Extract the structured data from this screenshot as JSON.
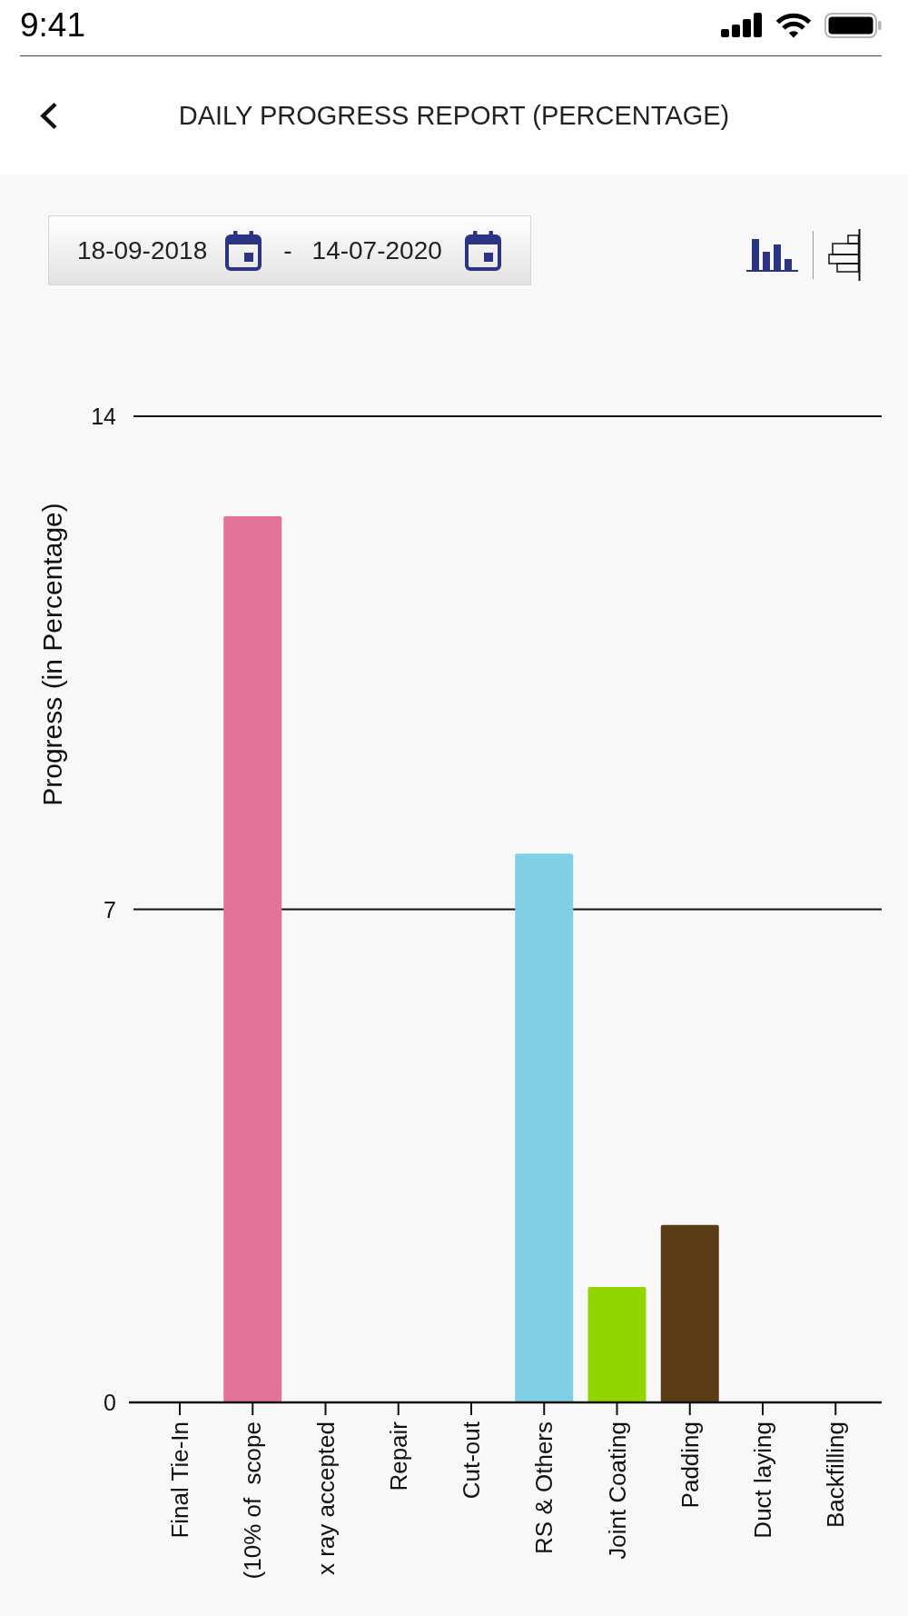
{
  "status_bar": {
    "time": "9:41"
  },
  "header": {
    "title": "DAILY PROGRESS REPORT (PERCENTAGE)"
  },
  "date_range": {
    "start": "18-09-2018",
    "separator": "-",
    "end": "14-07-2020"
  },
  "chart_view_toggle": [
    {
      "kind": "vertical",
      "selected": true
    },
    {
      "kind": "horizontal",
      "selected": false
    }
  ],
  "chart": {
    "chart_data": {
      "type": "bar",
      "ylabel": "Progress (in Percentage)",
      "categories": [
        "Final Tie-In",
        "(10% of  scope",
        "x ray accepted",
        "Repair",
        "Cut-out",
        "RS & Others",
        "Joint Coating",
        "Padding",
        "Duct laying",
        "Backfilling"
      ],
      "values": [
        0,
        12.58,
        0,
        0,
        0,
        7.79,
        1.64,
        2.52,
        0,
        0
      ],
      "colors": [
        null,
        "#e37298",
        null,
        null,
        null,
        "#7fd0e5",
        "#92d500",
        "#5a3c17",
        null,
        null
      ],
      "ylim": [
        0,
        14
      ],
      "yticks": [
        0,
        7,
        14
      ]
    }
  }
}
